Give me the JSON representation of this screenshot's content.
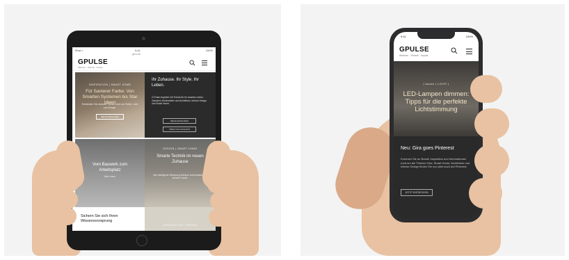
{
  "tablet": {
    "status": {
      "network": "iPad ≈",
      "time": "9:41",
      "url": "gira.de",
      "battery": "100%"
    },
    "logo": "GPULSE",
    "tagline": "Wohnen · Technik · Impuls",
    "tiles": {
      "a": {
        "mini": "INSPIRATION | SMART HOME",
        "title": "Für Sanierer Farbe: Von Smarten Systemen bis Star Ideen",
        "body": "Entdecken Sie aktuelle Trends rund um Farbe, Licht und Design.",
        "button": "MEHR ERFAHREN"
      },
      "b": {
        "title": "Ihr Zuhause. Ihr Style. Ihr Leben.",
        "body": "G-Pulse inspiriert mit Trends für Ihr smartes Leben. Zwischen Wohnwelten und Architektur, Interior Design und Smart Home.",
        "button1": "MEHR ERFAHREN",
        "button2": "ÜBER DAS MAGAZIN"
      },
      "c": {
        "title": "Vom Bauwerk zum Arbeitsplatz",
        "body": "Mehr lesen"
      },
      "d": {
        "mini": "DESIGN | SMART HOME",
        "title": "Smarte Technik im neuen Zuhause",
        "body": "Wie intelligente Steuerung Wohnen komfortabler und sicherer macht."
      },
      "e": {
        "title": "Sichern Sie sich Ihren Wissensvorsprung"
      },
      "f": {
        "mini": "ARCHITEKTUR | TRENDS"
      }
    }
  },
  "phone": {
    "status": {
      "time": "9:41",
      "battery": "100%"
    },
    "logo": "GPULSE",
    "tagline": "Wohnen · Technik · Impuls",
    "hero": {
      "mini": "| bauen | LICHT |",
      "title": "LED-Lampen dimmen: Tipps für die perfekte Lichtstimmung"
    },
    "teaser": {
      "title": "Neu: Gira goes Pinterest",
      "text": "Kommen Sie an Board! Inspiration und Informationen rund um die Themen Gira, Smart Home, Architektur und Interior Design finden Sie nun jetzt auch auf Pinterest.",
      "button": "JETZT ENTDECKEN"
    }
  }
}
